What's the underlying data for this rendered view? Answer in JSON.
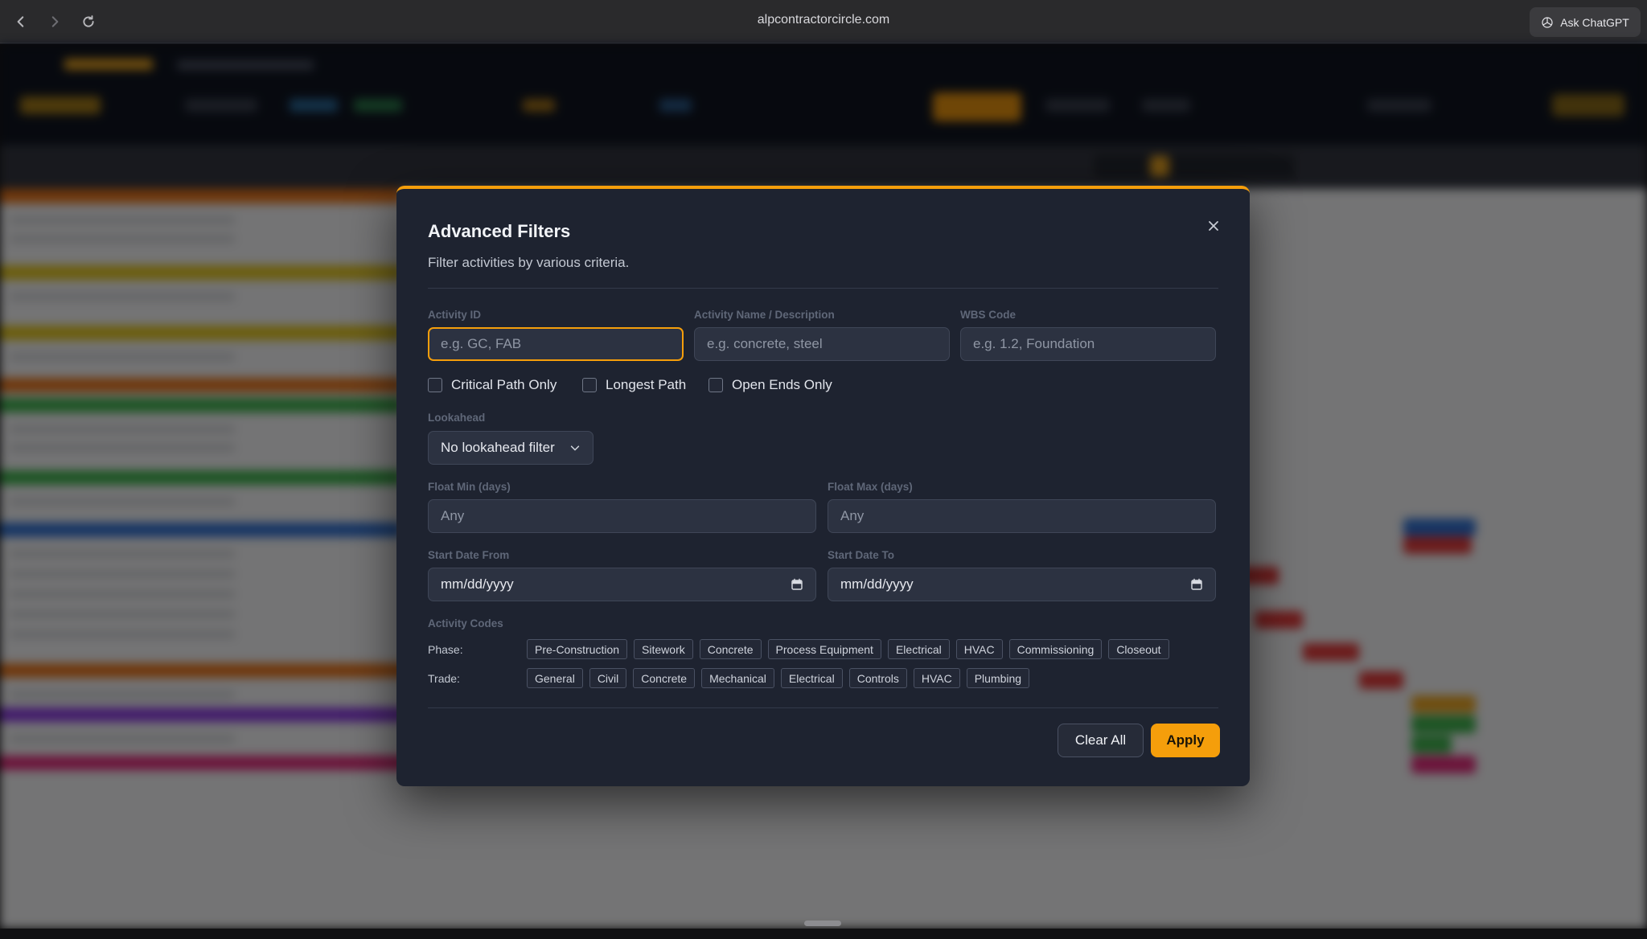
{
  "browser": {
    "url": "alpcontractorcircle.com",
    "ask_chatgpt_label": "Ask ChatGPT",
    "back_icon": "chevron-left-icon",
    "forward_icon": "chevron-right-icon",
    "reload_icon": "reload-icon"
  },
  "colors": {
    "accent": "#f59e0b",
    "modal_bg": "#1e2330",
    "input_bg": "#2c3241"
  },
  "modal": {
    "title": "Advanced Filters",
    "subtitle": "Filter activities by various criteria.",
    "fields": {
      "activity_id": {
        "label": "Activity ID",
        "placeholder": "e.g. GC, FAB",
        "value": ""
      },
      "activity_name": {
        "label": "Activity Name / Description",
        "placeholder": "e.g. concrete, steel",
        "value": ""
      },
      "wbs_code": {
        "label": "WBS Code",
        "placeholder": "e.g. 1.2, Foundation",
        "value": ""
      }
    },
    "checkboxes": [
      {
        "label": "Critical Path Only",
        "checked": false
      },
      {
        "label": "Longest Path",
        "checked": false
      },
      {
        "label": "Open Ends Only",
        "checked": false
      }
    ],
    "lookahead": {
      "label": "Lookahead",
      "selected": "No lookahead filter"
    },
    "float_min": {
      "label": "Float Min (days)",
      "placeholder": "Any",
      "value": ""
    },
    "float_max": {
      "label": "Float Max (days)",
      "placeholder": "Any",
      "value": ""
    },
    "start_date_from": {
      "label": "Start Date From",
      "value": "mm/dd/yyyy"
    },
    "start_date_to": {
      "label": "Start Date To",
      "value": "mm/dd/yyyy"
    },
    "activity_codes": {
      "label": "Activity Codes",
      "phase": {
        "label": "Phase:",
        "options": [
          "Pre-Construction",
          "Sitework",
          "Concrete",
          "Process Equipment",
          "Electrical",
          "HVAC",
          "Commissioning",
          "Closeout"
        ]
      },
      "trade": {
        "label": "Trade:",
        "options": [
          "General",
          "Civil",
          "Concrete",
          "Mechanical",
          "Electrical",
          "Controls",
          "HVAC",
          "Plumbing"
        ]
      }
    },
    "clear_label": "Clear All",
    "apply_label": "Apply"
  }
}
